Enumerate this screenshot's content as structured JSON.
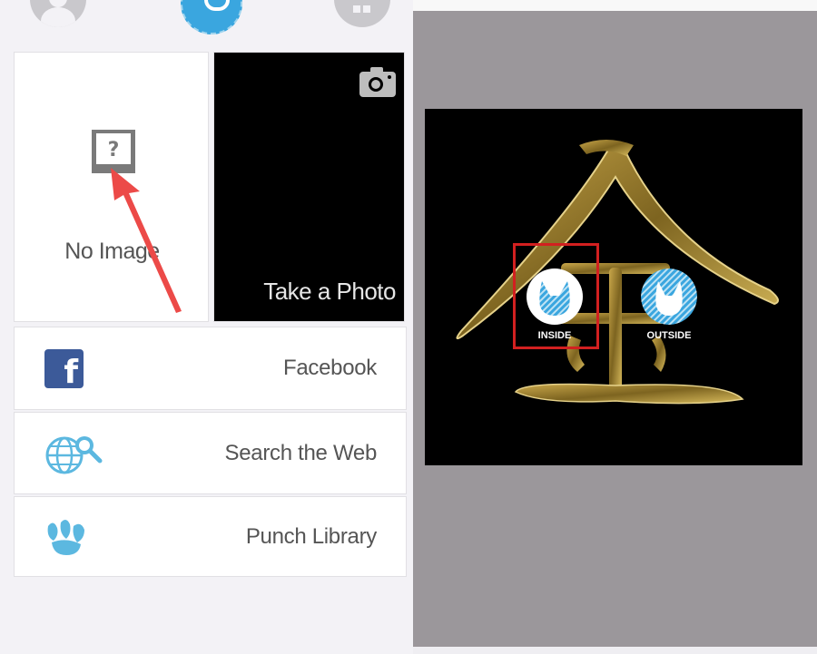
{
  "left": {
    "tiles": {
      "no_image_label": "No Image",
      "take_photo_label": "Take a Photo"
    },
    "sources": [
      {
        "label": "Facebook",
        "icon": "facebook-icon"
      },
      {
        "label": "Search the Web",
        "icon": "globe-search-icon"
      },
      {
        "label": "Punch Library",
        "icon": "punch-library-icon"
      }
    ],
    "top_icons": [
      "avatar-icon",
      "app-logo-icon",
      "menu-icon"
    ]
  },
  "right": {
    "options": {
      "inside_label": "INSIDE",
      "outside_label": "OUTSIDE"
    },
    "highlighted_option": "INSIDE"
  },
  "colors": {
    "accent_blue": "#3aa6df",
    "facebook_blue": "#3c5a99",
    "highlight_red": "#d22020",
    "gold": "#a88a2e"
  }
}
